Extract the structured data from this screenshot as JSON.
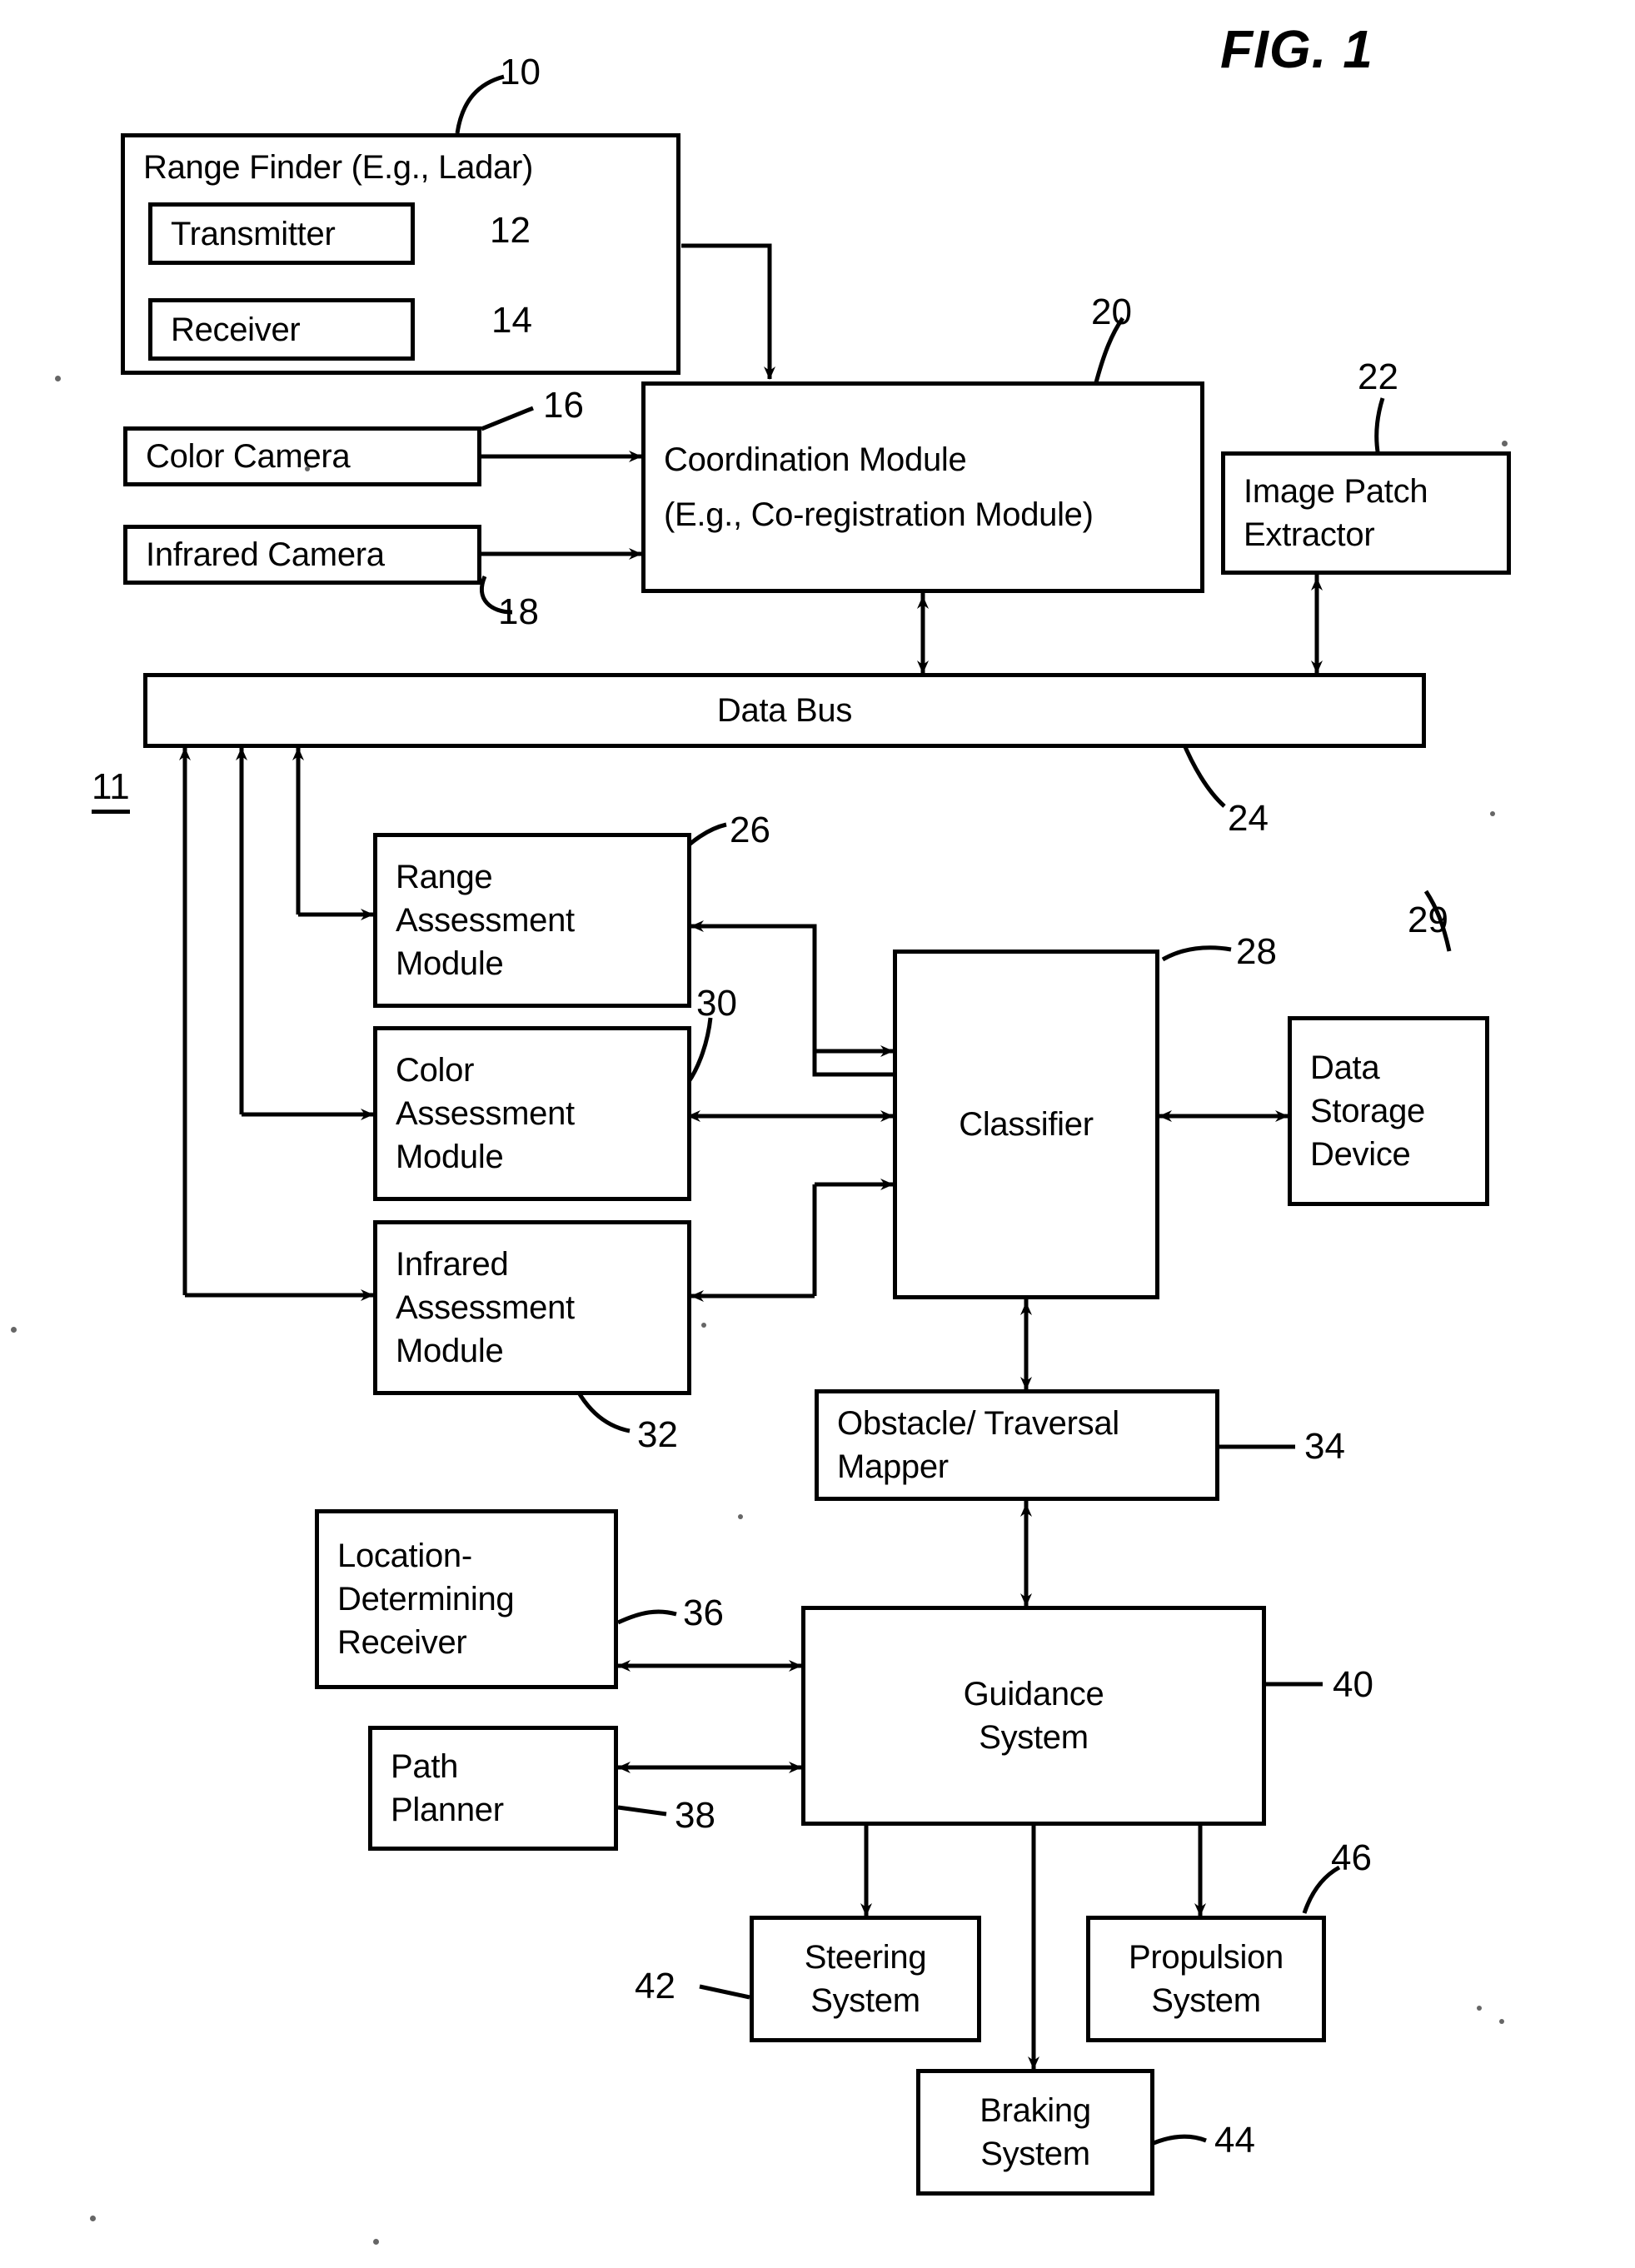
{
  "figure": {
    "title": "FIG. 1",
    "system_ref": "11"
  },
  "blocks": [
    {
      "id": "range_finder",
      "lines": [
        "Range Finder (E.g., Ladar)"
      ],
      "ref": "10"
    },
    {
      "id": "transmitter",
      "lines": [
        "Transmitter"
      ],
      "ref": "12"
    },
    {
      "id": "receiver",
      "lines": [
        "Receiver"
      ],
      "ref": "14"
    },
    {
      "id": "color_camera",
      "lines": [
        "Color Camera"
      ],
      "ref": "16"
    },
    {
      "id": "infrared_camera",
      "lines": [
        "Infrared Camera"
      ],
      "ref": "18"
    },
    {
      "id": "coordination_module",
      "lines": [
        "Coordination Module",
        "(E.g., Co-registration Module)"
      ],
      "ref": "20"
    },
    {
      "id": "image_patch_extractor",
      "lines": [
        "Image Patch",
        "Extractor"
      ],
      "ref": "22"
    },
    {
      "id": "data_bus",
      "lines": [
        "Data Bus"
      ],
      "ref": "24"
    },
    {
      "id": "range_assessment_module",
      "lines": [
        "Range",
        "Assessment",
        "Module"
      ],
      "ref": "26"
    },
    {
      "id": "color_assessment_module",
      "lines": [
        "Color",
        "Assessment",
        "Module"
      ],
      "ref": "30"
    },
    {
      "id": "infrared_assessment_module",
      "lines": [
        "Infrared",
        "Assessment",
        "Module"
      ],
      "ref": "32"
    },
    {
      "id": "classifier",
      "lines": [
        "Classifier"
      ],
      "ref": "28"
    },
    {
      "id": "data_storage_device",
      "lines": [
        "Data",
        "Storage",
        "Device"
      ],
      "ref": "29"
    },
    {
      "id": "obstacle_traversal_mapper",
      "lines": [
        "Obstacle/ Traversal",
        "Mapper"
      ],
      "ref": "34"
    },
    {
      "id": "location_determining_receiver",
      "lines": [
        "Location-",
        "Determining",
        "Receiver"
      ],
      "ref": "36"
    },
    {
      "id": "path_planner",
      "lines": [
        "Path",
        "Planner"
      ],
      "ref": "38"
    },
    {
      "id": "guidance_system",
      "lines": [
        "Guidance",
        "System"
      ],
      "ref": "40"
    },
    {
      "id": "steering_system",
      "lines": [
        "Steering",
        "System"
      ],
      "ref": "42"
    },
    {
      "id": "propulsion_system",
      "lines": [
        "Propulsion",
        "System"
      ],
      "ref": "46"
    },
    {
      "id": "braking_system",
      "lines": [
        "Braking",
        "System"
      ],
      "ref": "44"
    }
  ],
  "labels": {
    "range_finder": "Range Finder (E.g., Ladar)",
    "transmitter": "Transmitter",
    "receiver": "Receiver",
    "color_camera": "Color Camera",
    "infrared_camera": "Infrared Camera",
    "coordination_module_l1": "Coordination Module",
    "coordination_module_l2": "(E.g., Co-registration Module)",
    "image_patch_extractor_l1": "Image Patch",
    "image_patch_extractor_l2": "Extractor",
    "data_bus": "Data Bus",
    "range_assessment_l1": "Range",
    "range_assessment_l2": "Assessment",
    "range_assessment_l3": "Module",
    "color_assessment_l1": "Color",
    "color_assessment_l2": "Assessment",
    "color_assessment_l3": "Module",
    "infrared_assessment_l1": "Infrared",
    "infrared_assessment_l2": "Assessment",
    "infrared_assessment_l3": "Module",
    "classifier": "Classifier",
    "data_storage_l1": "Data",
    "data_storage_l2": "Storage",
    "data_storage_l3": "Device",
    "obstacle_mapper_l1": "Obstacle/ Traversal",
    "obstacle_mapper_l2": "Mapper",
    "location_receiver_l1": "Location-",
    "location_receiver_l2": "Determining",
    "location_receiver_l3": "Receiver",
    "path_planner_l1": "Path",
    "path_planner_l2": "Planner",
    "guidance_l1": "Guidance",
    "guidance_l2": "System",
    "steering_l1": "Steering",
    "steering_l2": "System",
    "propulsion_l1": "Propulsion",
    "propulsion_l2": "System",
    "braking_l1": "Braking",
    "braking_l2": "System"
  },
  "refs": {
    "r10": "10",
    "r11": "11",
    "r12": "12",
    "r14": "14",
    "r16": "16",
    "r18": "18",
    "r20": "20",
    "r22": "22",
    "r24": "24",
    "r26": "26",
    "r28": "28",
    "r29": "29",
    "r30": "30",
    "r32": "32",
    "r34": "34",
    "r36": "36",
    "r38": "38",
    "r40": "40",
    "r42": "42",
    "r44": "44",
    "r46": "46"
  },
  "colors": {
    "ink": "#000000",
    "paper": "#ffffff"
  }
}
